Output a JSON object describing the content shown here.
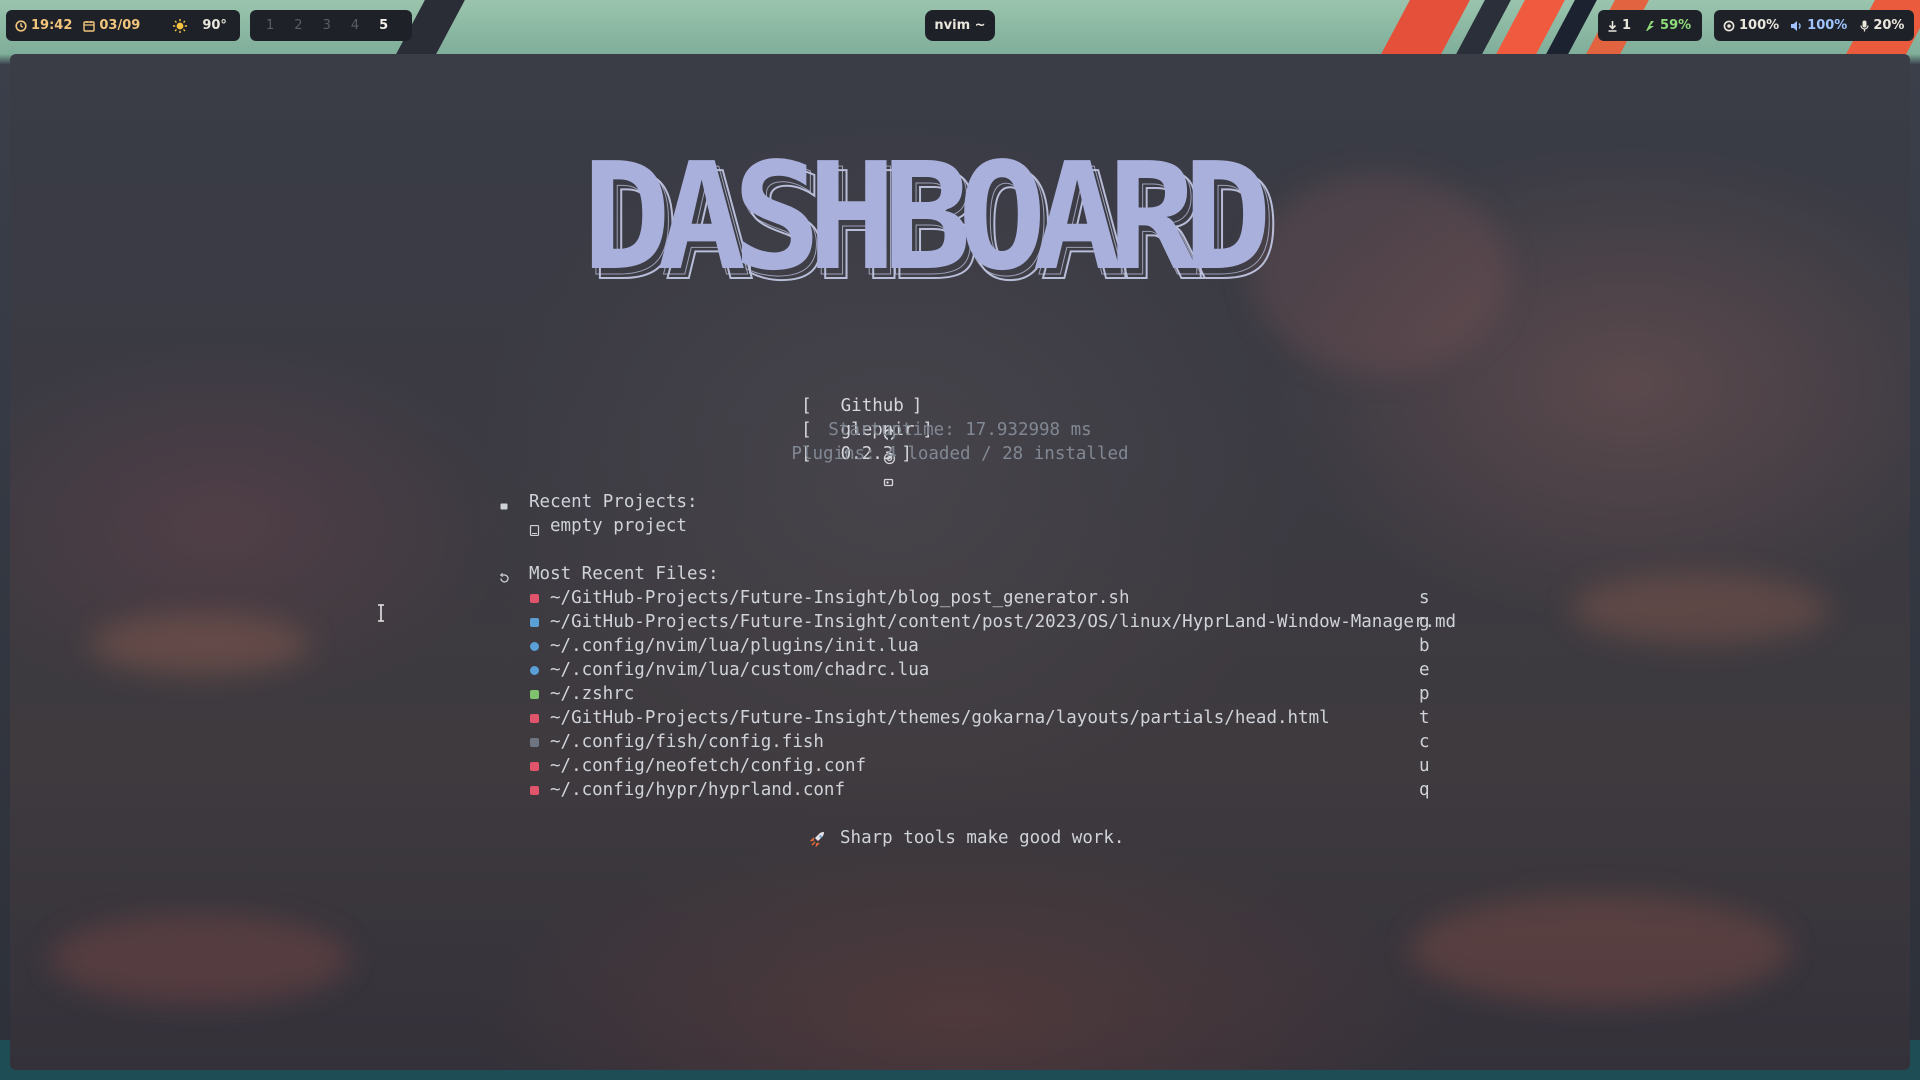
{
  "topbar": {
    "time": "19:42",
    "date": "03/09",
    "weather_temp": "90°",
    "workspaces": [
      "1",
      "2",
      "3",
      "4",
      "5"
    ],
    "active_workspace": "5",
    "window_title": "nvim ~",
    "updates": "1",
    "battery": "59%",
    "brightness": "100%",
    "volume": "100%",
    "mic": "20%"
  },
  "dashboard": {
    "banner": "DASHBOARD",
    "links": {
      "github": "Github",
      "user": "glepnir",
      "version": "0.2.3"
    },
    "startuptime": "Startuptime: 17.932998 ms",
    "plugins": "Plugins: 4 loaded / 28 installed",
    "recent_projects_title": "Recent Projects:",
    "recent_projects": [
      "empty project"
    ],
    "recent_files_title": "Most Recent Files:",
    "recent_files": [
      {
        "path": "~/GitHub-Projects/Future-Insight/blog_post_generator.sh",
        "key": "s",
        "icon_color": "#e0556c",
        "icon": "shell-file-icon"
      },
      {
        "path": "~/GitHub-Projects/Future-Insight/content/post/2023/OS/linux/HyprLand-Window-Manager.md",
        "key": "g",
        "icon_color": "#5a9fd6",
        "icon": "markdown-file-icon"
      },
      {
        "path": "~/.config/nvim/lua/plugins/init.lua",
        "key": "b",
        "icon_color": "#5a9fd6",
        "icon": "lua-file-icon"
      },
      {
        "path": "~/.config/nvim/lua/custom/chadrc.lua",
        "key": "e",
        "icon_color": "#5a9fd6",
        "icon": "lua-file-icon"
      },
      {
        "path": "~/.zshrc",
        "key": "p",
        "icon_color": "#7ec16e",
        "icon": "terminal-file-icon"
      },
      {
        "path": "~/GitHub-Projects/Future-Insight/themes/gokarna/layouts/partials/head.html",
        "key": "t",
        "icon_color": "#e0556c",
        "icon": "html-file-icon"
      },
      {
        "path": "~/.config/fish/config.fish",
        "key": "c",
        "icon_color": "#6e7480",
        "icon": "fish-file-icon"
      },
      {
        "path": "~/.config/neofetch/config.conf",
        "key": "u",
        "icon_color": "#e0556c",
        "icon": "config-file-icon"
      },
      {
        "path": "~/.config/hypr/hyprland.conf",
        "key": "q",
        "icon_color": "#e0556c",
        "icon": "config-file-icon"
      }
    ],
    "footer": "Sharp tools make good work."
  },
  "colors": {
    "banner_fill": "#a9b0dc",
    "bar_bg": "#1f2129",
    "battery_green": "#8fdc7a",
    "volume_blue": "#9fc3ff"
  }
}
